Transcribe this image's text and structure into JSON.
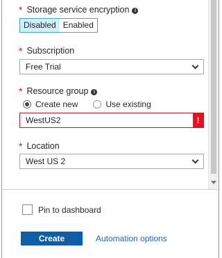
{
  "encryption": {
    "required_mark": "*",
    "label": "Storage service encryption",
    "info_glyph": "i",
    "options": [
      "Disabled",
      "Enabled"
    ],
    "selected": "Disabled"
  },
  "subscription": {
    "required_mark": "*",
    "label": "Subscription",
    "value": "Free Trial"
  },
  "resource_group": {
    "required_mark": "*",
    "label": "Resource group",
    "info_glyph": "i",
    "radio_create_new": "Create new",
    "radio_use_existing": "Use existing",
    "selected": "Create new",
    "input_value": "WestUS2",
    "error_glyph": "!"
  },
  "location": {
    "required_mark": "*",
    "label": "Location",
    "value": "West US 2"
  },
  "footer": {
    "pin_label": "Pin to dashboard",
    "pin_checked": false,
    "create_label": "Create",
    "automation_label": "Automation options"
  },
  "colors": {
    "required": "#e81123",
    "primary_button": "#0f5ea3",
    "link": "#1667b4",
    "selected_toggle": "#d2eef7",
    "error_border": "#c8171e"
  }
}
